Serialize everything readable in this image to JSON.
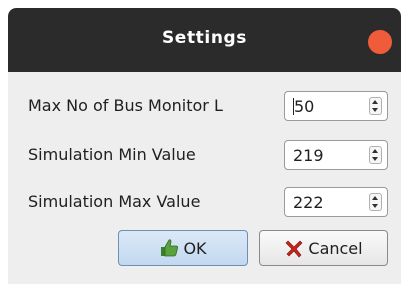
{
  "dialog": {
    "title": "Settings"
  },
  "fields": [
    {
      "label": "Max No of Bus Monitor L",
      "value": "50"
    },
    {
      "label": "Simulation Min Value",
      "value": "219"
    },
    {
      "label": "Simulation Max Value",
      "value": "222"
    }
  ],
  "buttons": {
    "ok_label": "OK",
    "cancel_label": "Cancel"
  },
  "colors": {
    "titlebar": "#2b2b2b",
    "close": "#f05c3a",
    "ok_button": "#c3d8ef"
  },
  "icons": {
    "ok": "thumbs-up-icon",
    "cancel": "red-x-icon"
  }
}
